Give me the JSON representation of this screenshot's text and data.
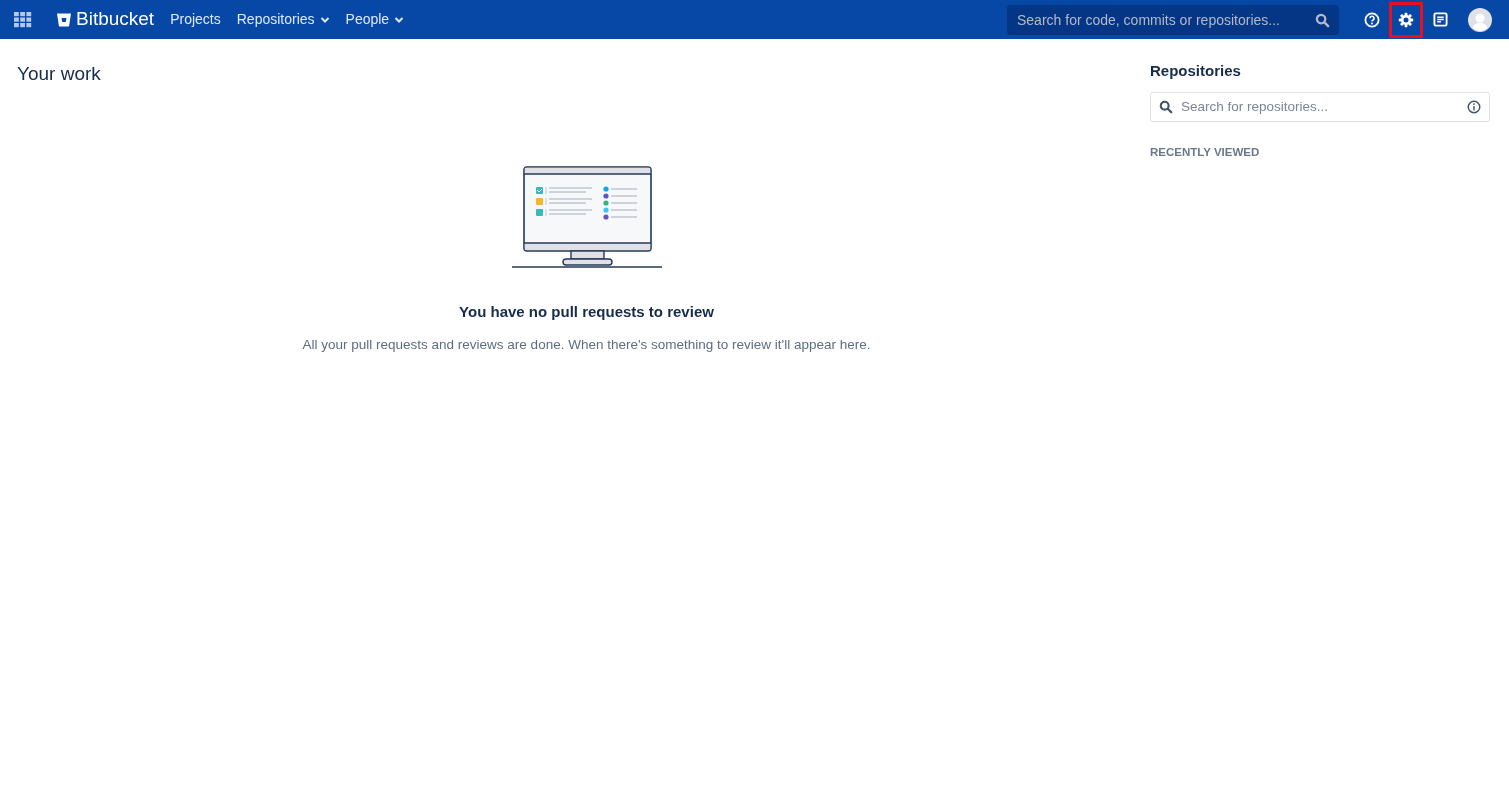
{
  "header": {
    "brand": "Bitbucket",
    "nav": [
      {
        "label": "Projects",
        "dropdown": false
      },
      {
        "label": "Repositories",
        "dropdown": true
      },
      {
        "label": "People",
        "dropdown": true
      }
    ],
    "search": {
      "placeholder": "Search for code, commits or repositories..."
    },
    "icons": [
      {
        "kind": "help",
        "highlighted": false
      },
      {
        "kind": "settings",
        "highlighted": true
      },
      {
        "kind": "notes",
        "highlighted": false
      },
      {
        "kind": "avatar",
        "highlighted": false
      }
    ]
  },
  "main": {
    "title": "Your work",
    "empty_title": "You have no pull requests to review",
    "empty_text": "All your pull requests and reviews are done. When there's something to review it'll appear here."
  },
  "sidebar": {
    "title": "Repositories",
    "search": {
      "placeholder": "Search for repositories..."
    },
    "section": "RECENTLY VIEWED"
  }
}
